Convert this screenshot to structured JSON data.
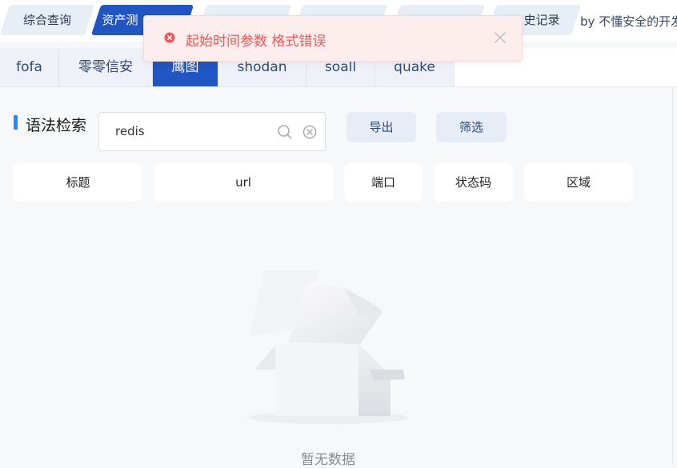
{
  "top_tabs": [
    {
      "label": "综合查询"
    },
    {
      "label": "资产测"
    },
    {
      "label": ""
    },
    {
      "label": ""
    },
    {
      "label": ""
    },
    {
      "label": "史记录"
    }
  ],
  "byline": "by 不懂安全的开发",
  "sub_tabs": [
    {
      "label": "fofa"
    },
    {
      "label": "零零信安"
    },
    {
      "label": "鹰图"
    },
    {
      "label": "shodan"
    },
    {
      "label": "soall"
    },
    {
      "label": "quake"
    }
  ],
  "active_sub_tab": "鹰图",
  "search": {
    "section_title": "语法检索",
    "value": "redis",
    "placeholder": ""
  },
  "buttons": {
    "export": "导出",
    "filter": "筛选"
  },
  "columns": [
    "标题",
    "url",
    "端口",
    "状态码",
    "区域"
  ],
  "empty": {
    "text": "暂无数据"
  },
  "toast": {
    "type": "error",
    "message": "起始时间参数 格式错误"
  },
  "colors": {
    "primary": "#1f56c3",
    "error": "#f05656",
    "accent_bar": "#1f8bff"
  }
}
